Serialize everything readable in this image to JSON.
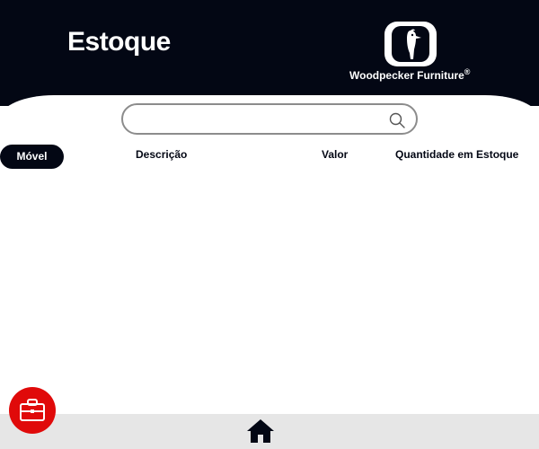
{
  "header": {
    "title": "Estoque",
    "brand": {
      "name": "Woodpecker Furniture",
      "mark": "®",
      "icon": "woodpecker-logo-icon"
    }
  },
  "search": {
    "value": "",
    "placeholder": "",
    "icon": "search-icon"
  },
  "table": {
    "columns": [
      {
        "label": "Móvel",
        "active": true
      },
      {
        "label": "Descrição",
        "active": false
      },
      {
        "label": "Valor",
        "active": false
      },
      {
        "label": "Quantidade em Estoque",
        "active": false
      }
    ],
    "rows": []
  },
  "footer": {
    "icon": "home-icon"
  },
  "fab": {
    "icon": "briefcase-icon"
  },
  "colors": {
    "header_bg": "#030714",
    "accent": "#e00a0a",
    "footer_bg": "#e6e6e6",
    "text_dark": "#030714"
  }
}
